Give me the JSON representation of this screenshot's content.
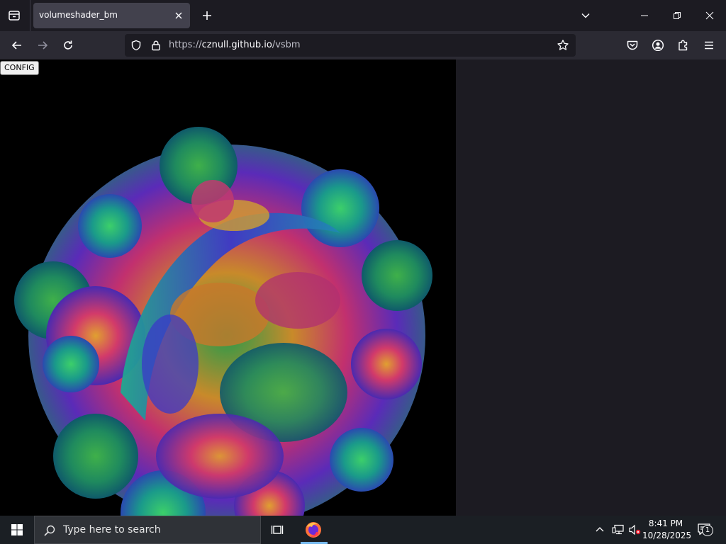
{
  "browser": {
    "tab_title": "volumeshader_bm",
    "url_prefix": "https://",
    "url_domain": "cznull.github.io",
    "url_path": "/vsbm"
  },
  "page": {
    "config_label": "CONFIG"
  },
  "taskbar": {
    "search_placeholder": "Type here to search",
    "time": "8:41 PM",
    "date": "10/28/2025",
    "notification_count": "1"
  },
  "icons": {
    "tab_list": "tab-list-icon",
    "tab_close": "close-icon",
    "new_tab": "plus-icon",
    "list_all_tabs": "chevron-down-icon",
    "minimize": "minimize-icon",
    "restore": "restore-icon",
    "close_window": "close-icon",
    "back": "arrow-left-icon",
    "forward": "arrow-right-icon",
    "reload": "reload-icon",
    "tracking_protection": "shield-icon",
    "secure": "lock-icon",
    "bookmark": "star-icon",
    "pocket": "pocket-icon",
    "account": "account-icon",
    "extensions": "puzzle-icon",
    "menu": "hamburger-icon",
    "start": "windows-icon",
    "search": "search-icon",
    "task_view": "task-view-icon",
    "firefox": "firefox-icon",
    "tray_chevron": "chevron-up-icon",
    "network": "network-icon",
    "volume": "speaker-muted-icon",
    "notifications": "notification-icon"
  },
  "colors": {
    "tab_active_bg": "#42414d",
    "toolbar_bg": "#2b2a33",
    "urlbar_bg": "#1c1b22",
    "canvas_bg": "#000000",
    "taskbar_bg": "#1b1f24",
    "taskbar_active": "#76b9ed"
  }
}
